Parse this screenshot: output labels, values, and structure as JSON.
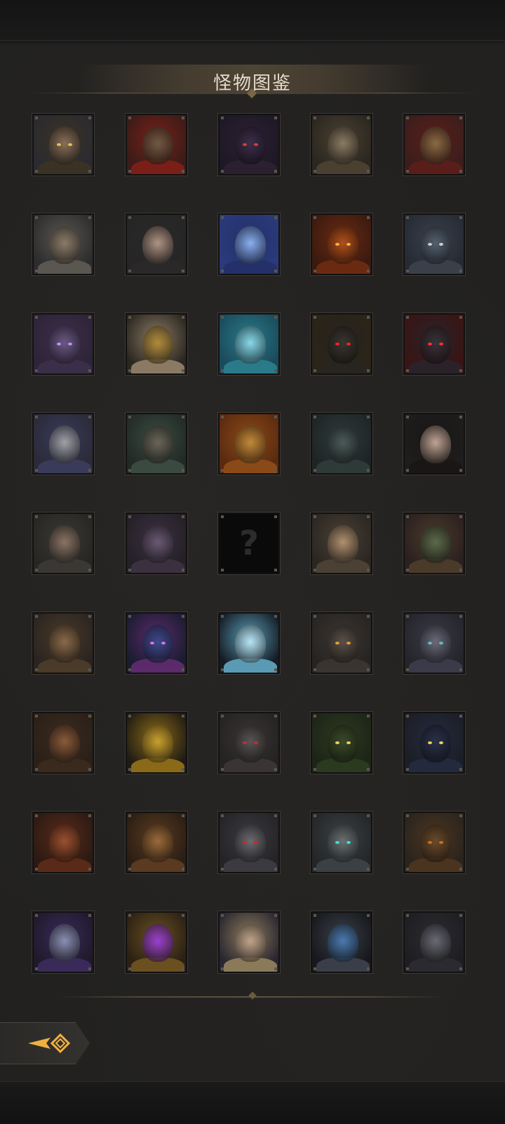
{
  "title": "怪物图鉴",
  "unknown_glyph": "?",
  "monsters": [
    {
      "icon": "dark-haired-warrior-portrait",
      "bg": "#2a2a30",
      "face": "#8a6f58",
      "body": "#3a3224",
      "eye": "#e0c060"
    },
    {
      "icon": "red-caped-knight-portrait",
      "bg": "#3a1c18",
      "face": "#6f5a44",
      "body": "#7a1f18",
      "eye": "#00000000"
    },
    {
      "icon": "purple-dragon-beast-portrait",
      "bg": "#1e1826",
      "face": "#3d2e4a",
      "body": "#2a2030",
      "eye": "#d04040"
    },
    {
      "icon": "helmeted-soldier-portrait",
      "bg": "#2a2620",
      "face": "#8a7a62",
      "body": "#4a4030",
      "eye": "#00000000"
    },
    {
      "icon": "gold-crowned-knight-portrait",
      "bg": "#3a1e1c",
      "face": "#8a6a44",
      "body": "#5a1e1a",
      "eye": "#00000000"
    },
    {
      "icon": "hooded-assassin-portrait",
      "bg": "#2c2c2e",
      "face": "#8a7a68",
      "body": "#5a5650",
      "eye": "#00000000"
    },
    {
      "icon": "dark-haired-maiden-portrait",
      "bg": "#262626",
      "face": "#b09484",
      "body": "#2a2828",
      "eye": "#00000000"
    },
    {
      "icon": "blue-energy-orb-portrait",
      "bg": "#2a3a7a",
      "face": "#8ab0f0",
      "body": "#24306a",
      "eye": "#00000000"
    },
    {
      "icon": "fire-demon-portrait",
      "bg": "#3a1a10",
      "face": "#b0501c",
      "body": "#6a2a12",
      "eye": "#ffb040"
    },
    {
      "icon": "grey-wolf-portrait",
      "bg": "#252a33",
      "face": "#55606e",
      "body": "#3a404a",
      "eye": "#d0d0d0"
    },
    {
      "icon": "shadow-dragon-portrait",
      "bg": "#2e2438",
      "face": "#6a5a84",
      "body": "#3a2e48",
      "eye": "#c090ff"
    },
    {
      "icon": "golden-masked-monk-portrait",
      "bg": "#2a2620",
      "face": "#b08a3a",
      "body": "#8a7a64",
      "eye": "#00000000"
    },
    {
      "icon": "ice-crystal-king-portrait",
      "bg": "#1a4a5a",
      "face": "#8ad8e8",
      "body": "#2a7a8a",
      "eye": "#00000000"
    },
    {
      "icon": "red-eyed-bear-portrait",
      "bg": "#2a2418",
      "face": "#3a3530",
      "body": "#28241e",
      "eye": "#ff2020"
    },
    {
      "icon": "horned-dark-lord-portrait",
      "bg": "#3a1414",
      "face": "#3a3238",
      "body": "#2a2228",
      "eye": "#ff3030"
    },
    {
      "icon": "silver-masked-rogue-portrait",
      "bg": "#2a2a38",
      "face": "#a0a0a8",
      "body": "#3a3a5a",
      "eye": "#00000000"
    },
    {
      "icon": "green-hooded-bandit-portrait",
      "bg": "#222a26",
      "face": "#6a6458",
      "body": "#3a4a40",
      "eye": "#00000000"
    },
    {
      "icon": "golden-pharaoh-portrait",
      "bg": "#5a2a10",
      "face": "#c08a3a",
      "body": "#8a4a18",
      "eye": "#00000000"
    },
    {
      "icon": "dark-jellyfish-portrait",
      "bg": "#1e2426",
      "face": "#4a5a58",
      "body": "#2e3a38",
      "eye": "#00000000"
    },
    {
      "icon": "dark-haired-noblewoman-portrait",
      "bg": "#1e1c1c",
      "face": "#c0a494",
      "body": "#1a1616",
      "eye": "#00000000"
    },
    {
      "icon": "bearded-wanderer-portrait",
      "bg": "#282624",
      "face": "#8a7464",
      "body": "#3a3834",
      "eye": "#00000000"
    },
    {
      "icon": "purple-jellyfish-portrait",
      "bg": "#242026",
      "face": "#6a5a74",
      "body": "#3a3040",
      "eye": "#00000000"
    },
    {
      "unknown": true
    },
    {
      "icon": "brown-haired-nobleman-portrait",
      "bg": "#2a2622",
      "face": "#b09070",
      "body": "#4a4034",
      "eye": "#00000000"
    },
    {
      "icon": "mushroom-goblin-portrait",
      "bg": "#2a2020",
      "face": "#5a6a4a",
      "body": "#4a3a2a",
      "eye": "#00000000"
    },
    {
      "icon": "horned-dwarf-portrait",
      "bg": "#2a2420",
      "face": "#8a6a4a",
      "body": "#4a3a2a",
      "eye": "#00000000"
    },
    {
      "icon": "blue-purple-dragon-portrait",
      "bg": "#1a1c30",
      "face": "#3a4a8a",
      "body": "#5a2a6a",
      "eye": "#e070e0"
    },
    {
      "icon": "frost-spirit-portrait",
      "bg": "#141c24",
      "face": "#b8e4f4",
      "body": "#5a9ab4",
      "eye": "#00000000"
    },
    {
      "icon": "grey-haired-orc-portrait",
      "bg": "#262422",
      "face": "#5a5048",
      "body": "#3a3430",
      "eye": "#e0a030"
    },
    {
      "icon": "pale-ghoul-portrait",
      "bg": "#24242a",
      "face": "#6a6a7a",
      "body": "#3a3a48",
      "eye": "#60c0c0"
    },
    {
      "icon": "wild-haired-orc-portrait",
      "bg": "#2a2018",
      "face": "#8a5a3a",
      "body": "#3a2a1e",
      "eye": "#00000000"
    },
    {
      "icon": "golden-dragon-portrait",
      "bg": "#201c14",
      "face": "#c8a030",
      "body": "#8a6a18",
      "eye": "#00000000"
    },
    {
      "icon": "masked-marauder-portrait",
      "bg": "#242222",
      "face": "#5a5454",
      "body": "#3a3434",
      "eye": "#c03030"
    },
    {
      "icon": "green-hooded-cyclops-portrait",
      "bg": "#1e2418",
      "face": "#3a4a28",
      "body": "#2a3a1e",
      "eye": "#f0d060"
    },
    {
      "icon": "blue-hooded-cyclops-portrait",
      "bg": "#1c1e26",
      "face": "#2a3048",
      "body": "#242a3e",
      "eye": "#f0d060"
    },
    {
      "icon": "red-cyclops-ogre-portrait",
      "bg": "#2a1a14",
      "face": "#9a5030",
      "body": "#5a2a18",
      "eye": "#00000000"
    },
    {
      "icon": "brown-cyclops-ogre-portrait",
      "bg": "#2a1e14",
      "face": "#9a6a3a",
      "body": "#5a3a20",
      "eye": "#00000000"
    },
    {
      "icon": "red-eyed-automaton-portrait",
      "bg": "#242426",
      "face": "#6a6a70",
      "body": "#3a3a40",
      "eye": "#e02020"
    },
    {
      "icon": "green-eyed-automaton-portrait",
      "bg": "#242628",
      "face": "#6a7070",
      "body": "#3a4044",
      "eye": "#40e0d0"
    },
    {
      "icon": "barrel-golem-portrait",
      "bg": "#2a241e",
      "face": "#6a4a2a",
      "body": "#4a3420",
      "eye": "#d07020"
    },
    {
      "icon": "jester-mask-portrait",
      "bg": "#1e1a2a",
      "face": "#8a90b0",
      "body": "#3a2a5a",
      "eye": "#00000000"
    },
    {
      "icon": "purple-arcane-orb-portrait",
      "bg": "#2a2014",
      "face": "#9a40d0",
      "body": "#6a5020",
      "eye": "#00000000"
    },
    {
      "icon": "elf-queen-portrait",
      "bg": "#2a2630",
      "face": "#c0a48a",
      "body": "#8a7a5a",
      "eye": "#00000000"
    },
    {
      "icon": "crystal-hooded-wraith-portrait",
      "bg": "#16181c",
      "face": "#4a7ab0",
      "body": "#3a3e48",
      "eye": "#00000000"
    },
    {
      "icon": "hooded-elf-ranger-portrait",
      "bg": "#1e1e22",
      "face": "#6a6a74",
      "body": "#2a2a30",
      "eye": "#00000000"
    }
  ]
}
